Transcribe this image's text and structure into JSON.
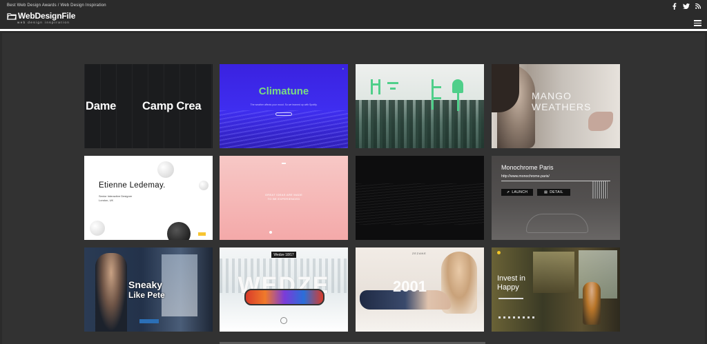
{
  "header": {
    "tagline": "Best Web Design Awards / Web Design Inspiration",
    "logo_main": "WebDesignFile",
    "logo_sub": "web design inspiration",
    "social": [
      "facebook-icon",
      "twitter-icon",
      "rss-icon"
    ],
    "menu_icon": "hamburger-menu-icon"
  },
  "gallery": {
    "cards": [
      {
        "id": "camp",
        "text_a": "Dame",
        "text_b": "Camp Crea"
      },
      {
        "id": "climatune",
        "title": "Climatune",
        "sub": "The weather affects your mood. So we teamed up with Spotify."
      },
      {
        "id": "forest"
      },
      {
        "id": "mango",
        "title_line1": "MANGO",
        "title_line2": "WEATHERS"
      },
      {
        "id": "etienne",
        "name": "Etienne Ledemay.",
        "role_line1": "Senior Interactive Designer",
        "role_line2": "London, UK"
      },
      {
        "id": "pink",
        "line1": "GREAT IDEAS ARE MADE",
        "line2": "TO BE EXPERIENCED"
      },
      {
        "id": "dark"
      },
      {
        "id": "monochrome",
        "title": "Monochrome Paris",
        "url": "http://www.monochrome.paris/",
        "launch": "LAUNCH",
        "detail": "DETAIL"
      },
      {
        "id": "sneaky",
        "line1": "Sneaky",
        "line2": "Like Pete"
      },
      {
        "id": "wedze",
        "tag": "Wedze 18/17",
        "big": "WEDZE"
      },
      {
        "id": "zadig",
        "brand": "ZEZANE",
        "num": "2001"
      },
      {
        "id": "invest",
        "line1": "Invest in",
        "line2": "Happy"
      }
    ]
  },
  "colors": {
    "page_bg": "#2b2b2b",
    "panel_bg": "#323232",
    "header_rule": "#ffffff",
    "climatune_green": "#7bdc82"
  }
}
